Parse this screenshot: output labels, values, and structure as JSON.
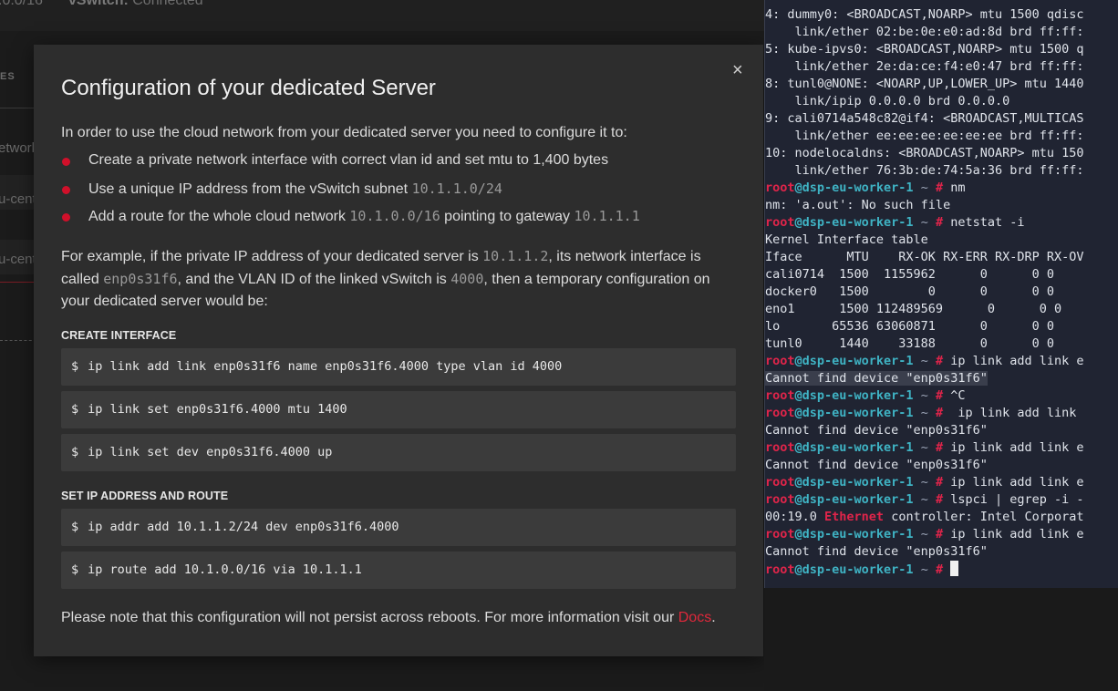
{
  "background": {
    "subnet_fragment": ".0.0/16",
    "vswitch_label": "vSwitch:",
    "vswitch_status": "Connected",
    "section_label": "ES",
    "item_network": "etwork",
    "item_cent_1": "u-cent",
    "item_cent_2": "u-cent"
  },
  "modal": {
    "title": "Configuration of your dedicated Server",
    "close_icon": "×",
    "intro": "In order to use the cloud network from your dedicated server you need to configure it to:",
    "bullets": {
      "b1": "Create a private network interface with correct vlan id and set mtu to 1,400 bytes",
      "b2_text": "Use a unique IP address from the vSwitch subnet ",
      "b2_code": "10.1.1.0/24",
      "b3_text": "Add a route for the whole cloud network ",
      "b3_code": "10.1.0.0/16",
      "b3_mid": " pointing to gateway ",
      "b3_code2": "10.1.1.1"
    },
    "example": {
      "t1": "For example, if the private IP address of your dedicated server is ",
      "c1": "10.1.1.2",
      "t2": ", its network interface is called ",
      "c2": "enp0s31f6",
      "t3": ", and the VLAN ID of the linked vSwitch is ",
      "c3": "4000",
      "t4": ", then a temporary configuration on your dedicated server would be:"
    },
    "create_interface_heading": "CREATE INTERFACE",
    "create_commands": [
      "ip link add link enp0s31f6 name enp0s31f6.4000 type vlan id 4000",
      "ip link set enp0s31f6.4000 mtu 1400",
      "ip link set dev enp0s31f6.4000 up"
    ],
    "ip_route_heading": "SET IP ADDRESS AND ROUTE",
    "route_commands": [
      "ip addr add 10.1.1.2/24 dev enp0s31f6.4000",
      "ip route add 10.1.0.0/16 via 10.1.1.1"
    ],
    "prompt_symbol": "$",
    "note_text": "Please note that this configuration will not persist across reboots. For more information visit our ",
    "note_link": "Docs",
    "note_end": "."
  },
  "terminal": {
    "prompt_user": "root",
    "prompt_host": "@dsp-eu-worker-1",
    "prompt_dir": " ~ ",
    "prompt_hash": "# ",
    "lines": {
      "l0": "4: dummy0: <BROADCAST,NOARP> mtu 1500 qdisc",
      "l1": "    link/ether 02:be:0e:e0:ad:8d brd ff:ff:",
      "l2": "5: kube-ipvs0: <BROADCAST,NOARP> mtu 1500 q",
      "l3": "    link/ether 2e:da:ce:f4:e0:47 brd ff:ff:",
      "l4": "8: tunl0@NONE: <NOARP,UP,LOWER_UP> mtu 1440",
      "l5": "    link/ipip 0.0.0.0 brd 0.0.0.0",
      "l6": "9: cali0714a548c82@if4: <BROADCAST,MULTICAS",
      "l7": "    link/ether ee:ee:ee:ee:ee:ee brd ff:ff:",
      "l8": "10: nodelocaldns: <BROADCAST,NOARP> mtu 150",
      "l9": "    link/ether 76:3b:de:74:5a:36 brd ff:ff:",
      "c10": "nm",
      "l11": "nm: 'a.out': No such file",
      "c12": "netstat -i",
      "l13": "Kernel Interface table",
      "l14": "Iface      MTU    RX-OK RX-ERR RX-DRP RX-OV",
      "l15": "cali0714  1500  1155962      0      0 0",
      "l16": "docker0   1500        0      0      0 0",
      "l17": "eno1      1500 112489569      0      0 0",
      "l18": "lo       65536 63060871      0      0 0",
      "l19": "tunl0     1440    33188      0      0 0",
      "c20": "ip link add link e",
      "l21": "Cannot find device \"enp0s31f6\"",
      "c22": "^C",
      "c23": " ip link add link",
      "l24": "Cannot find device \"enp0s31f6\"",
      "c25": "ip link add link e",
      "l26": "Cannot find device \"enp0s31f6\"",
      "c27": "ip link add link e",
      "c28": "lspci | egrep -i -",
      "l29a": "00:19.0 ",
      "l29b": "Ethernet",
      "l29c": " controller: Intel Corporat",
      "c30": "ip link add link e",
      "l31": "Cannot find device \"enp0s31f6\""
    }
  }
}
